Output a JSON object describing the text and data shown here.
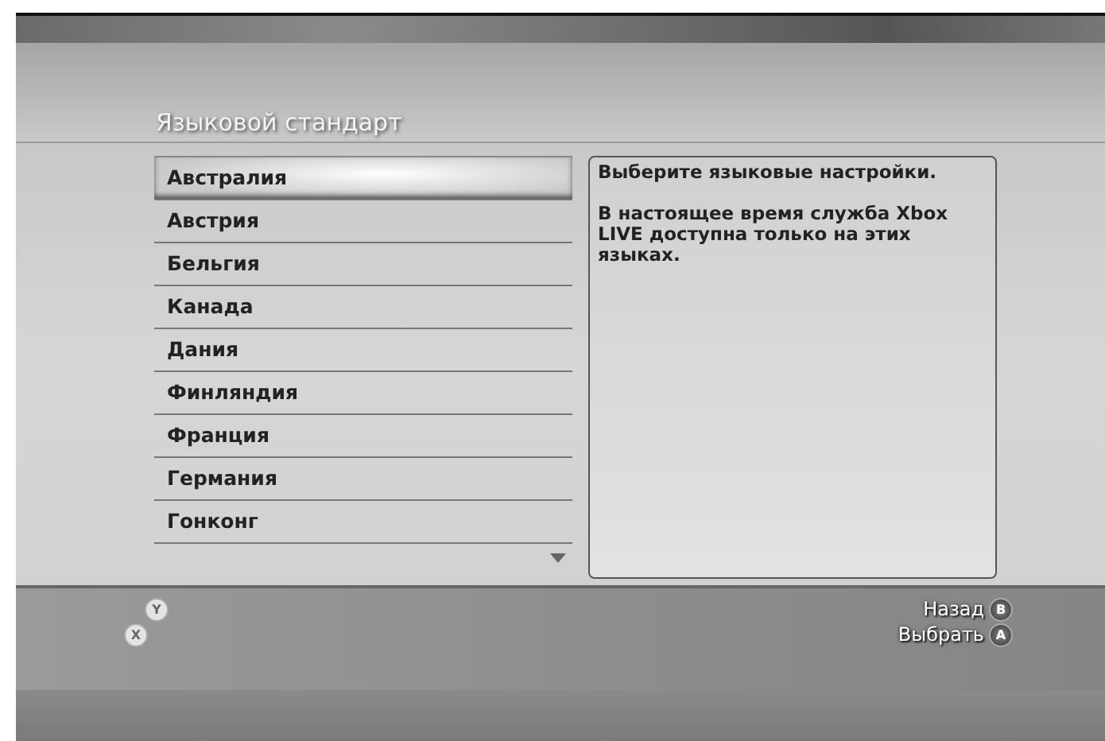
{
  "title": "Языковой стандарт",
  "list": [
    {
      "label": "Австралия",
      "selected": true
    },
    {
      "label": "Австрия",
      "selected": false
    },
    {
      "label": "Бельгия",
      "selected": false
    },
    {
      "label": "Канада",
      "selected": false
    },
    {
      "label": "Дания",
      "selected": false
    },
    {
      "label": "Финляндия",
      "selected": false
    },
    {
      "label": "Франция",
      "selected": false
    },
    {
      "label": "Германия",
      "selected": false
    },
    {
      "label": "Гонконг",
      "selected": false
    }
  ],
  "description": [
    "Выберите языковые настройки.",
    "В настоящее время служба Xbox LIVE доступна только на этих языках."
  ],
  "left_buttons": [
    {
      "key": "Y"
    },
    {
      "key": "X"
    }
  ],
  "right_buttons": [
    {
      "label": "Назад",
      "key": "B"
    },
    {
      "label": "Выбрать",
      "key": "A"
    }
  ]
}
